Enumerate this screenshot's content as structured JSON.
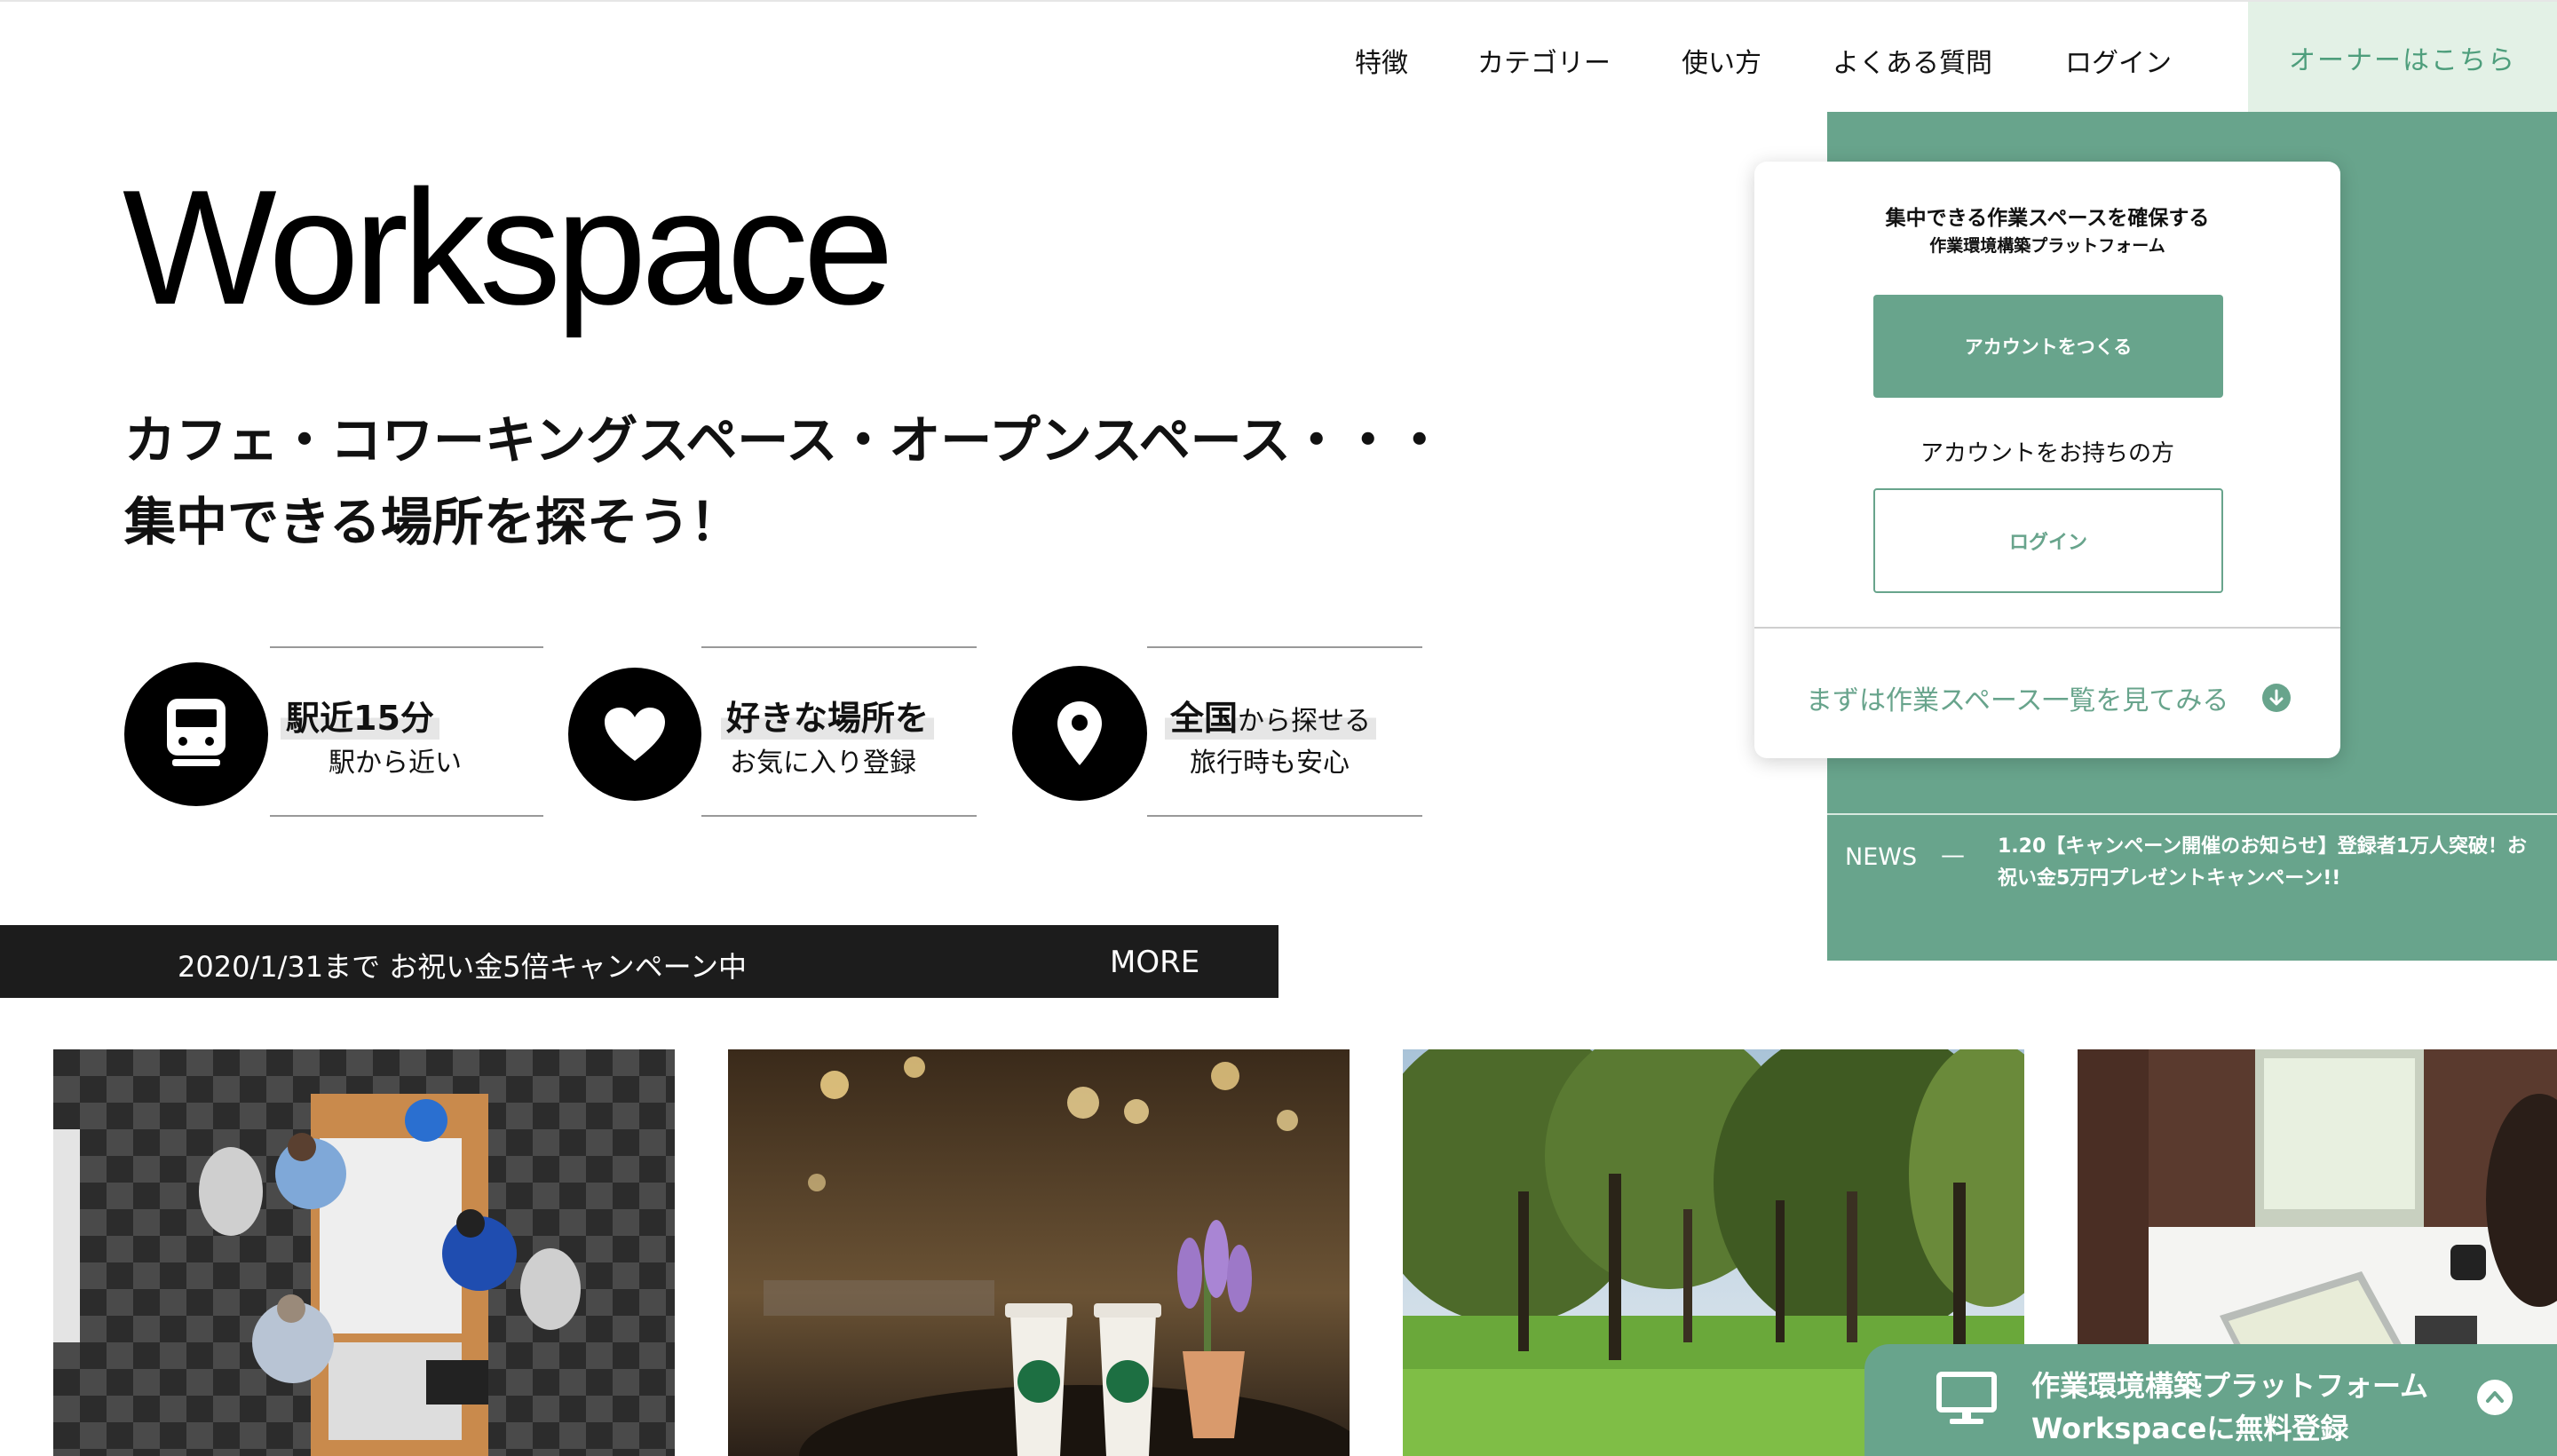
{
  "nav": {
    "items": [
      {
        "label": "特徴"
      },
      {
        "label": "カテゴリー"
      },
      {
        "label": "使い方"
      },
      {
        "label": "よくある質問"
      },
      {
        "label": "ログイン"
      }
    ],
    "owner_label": "オーナーはこちら"
  },
  "hero": {
    "logo": "Workspace",
    "copy_line1": "カフェ・コワーキングスペース・オープンスペース・・・",
    "copy_line2": "集中できる場所を探そう！"
  },
  "features": [
    {
      "icon": "train-icon",
      "main": "駅近15分",
      "sub": "駅から近い"
    },
    {
      "icon": "heart-icon",
      "main": "好きな場所を",
      "sub": "お気に入り登録"
    },
    {
      "icon": "map-pin-icon",
      "main_bold": "全国",
      "main_small": "から探せる",
      "sub": "旅行時も安心"
    }
  ],
  "campaign": {
    "text": "2020/1/31まで お祝い金5倍キャンペーン中",
    "more": "MORE"
  },
  "card": {
    "title": "集中できる作業スペースを確保する",
    "subtitle": "作業環境構築プラットフォーム",
    "create_account": "アカウントをつくる",
    "have_account": "アカウントをお持ちの方",
    "login": "ログイン",
    "list_link": "まずは作業スペース一覧を見てみる"
  },
  "news": {
    "label": "NEWS",
    "dash": "—",
    "text": "1.20【キャンペーン開催のお知らせ】登録者1万人突破！お祝い金5万円プレゼントキャンペーン!!"
  },
  "cta": {
    "line1": "作業環境構築プラットフォーム",
    "line2": "Workspaceに無料登録"
  },
  "colors": {
    "brand_green": "#68a48c",
    "owner_bg": "#e3f1e6",
    "dark_bar": "#1c1c1c"
  }
}
